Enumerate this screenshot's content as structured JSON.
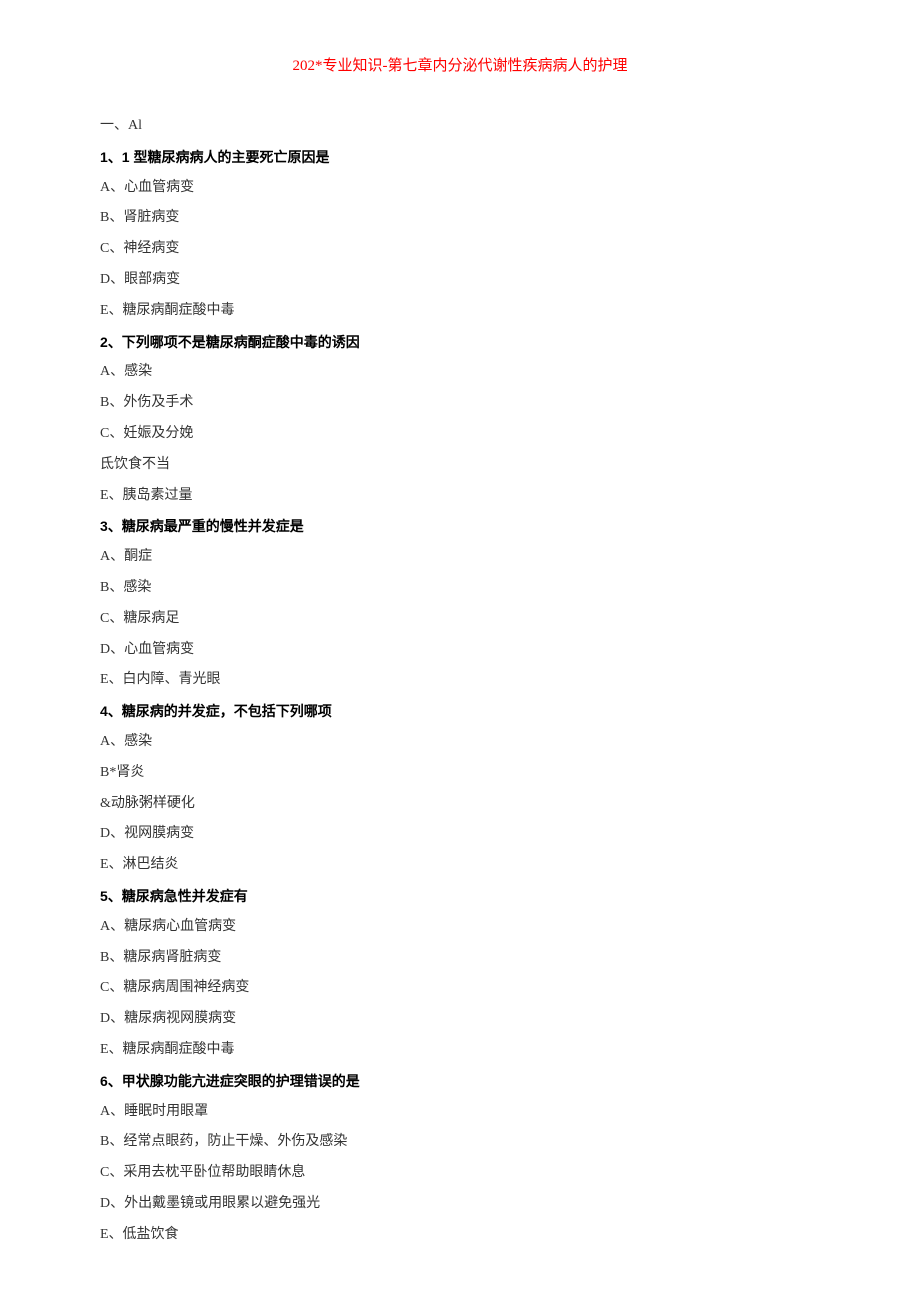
{
  "title": "202*专业知识-第七章内分泌代谢性疾病病人的护理",
  "sectionHeader": "一、Al",
  "questions": [
    {
      "q": "1、1 型糖尿病病人的主要死亡原因是",
      "options": [
        "A、心血管病变",
        "B、肾脏病变",
        "C、神经病变",
        "D、眼部病变",
        "E、糖尿病酮症酸中毒"
      ]
    },
    {
      "q": "2、下列哪项不是糖尿病酮症酸中毒的诱因",
      "options": [
        "A、感染",
        "B、外伤及手术",
        "C、妊娠及分娩",
        "氐饮食不当",
        "E、胰岛素过量"
      ]
    },
    {
      "q": "3、糖尿病最严重的慢性并发症是",
      "options": [
        "A、酮症",
        "B、感染",
        "C、糖尿病足",
        "D、心血管病变",
        "E、白内障、青光眼"
      ]
    },
    {
      "q": "4、糖尿病的并发症，不包括下列哪项",
      "options": [
        "A、感染",
        "B*肾炎",
        "&动脉粥样硬化",
        "D、视网膜病变",
        "E、淋巴结炎"
      ]
    },
    {
      "q": "5、糖尿病急性并发症有",
      "options": [
        "A、糖尿病心血管病变",
        "B、糖尿病肾脏病变",
        "C、糖尿病周围神经病变",
        "D、糖尿病视网膜病变",
        "E、糖尿病酮症酸中毒"
      ]
    },
    {
      "q": "6、甲状腺功能亢进症突眼的护理错误的是",
      "options": [
        "A、睡眠时用眼罩",
        "B、经常点眼药，防止干燥、外伤及感染",
        "C、采用去枕平卧位帮助眼睛休息",
        "D、外出戴墨镜或用眼累以避免强光",
        "E、低盐饮食"
      ]
    }
  ]
}
